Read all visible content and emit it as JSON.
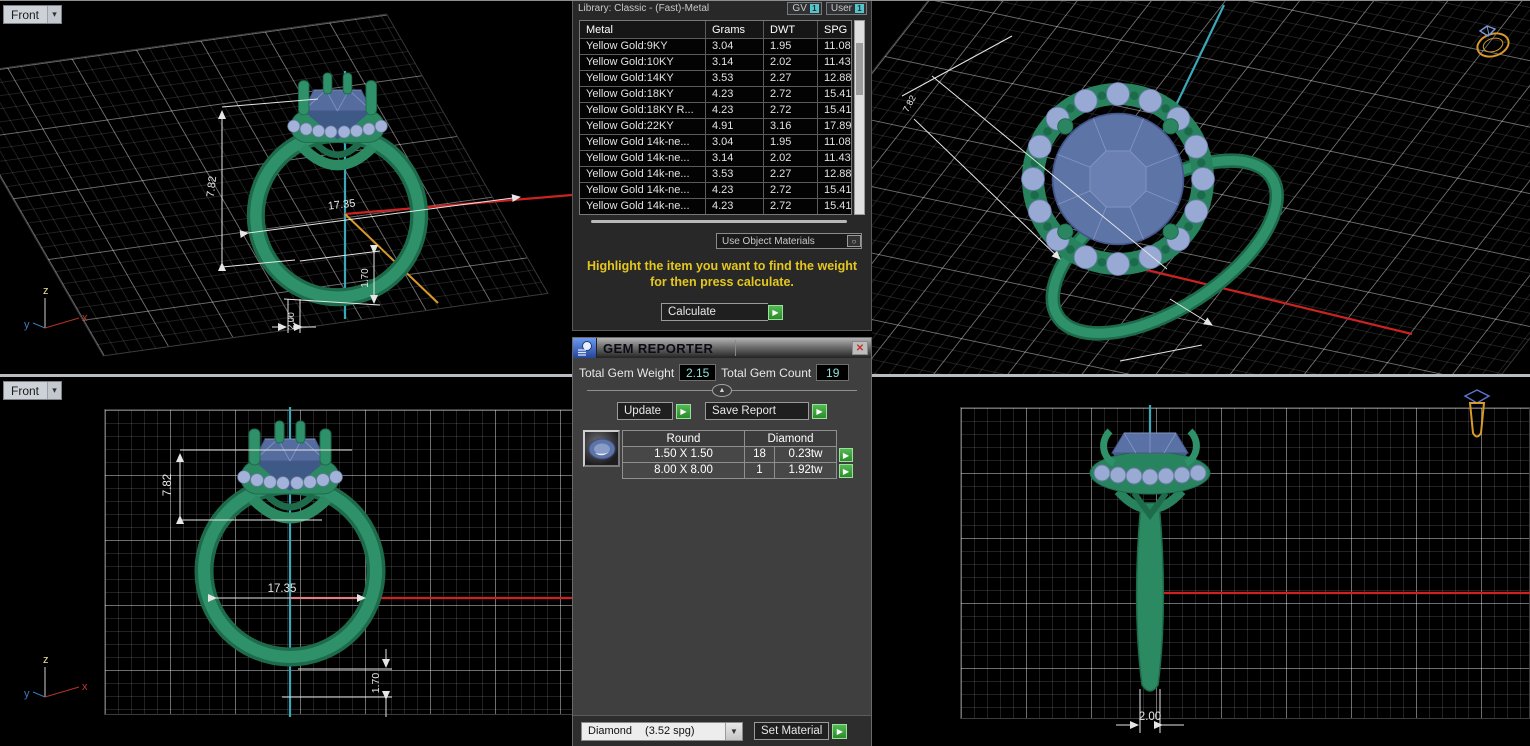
{
  "dims": {
    "head_height": "7.82",
    "ring_diameter": "17.35",
    "band_thickness": "1.70",
    "band_width": "2.00"
  },
  "viewports": {
    "top_left_label": "Front",
    "bottom_left_label": "Front",
    "axis": {
      "x": "x",
      "y": "y",
      "z": "z"
    },
    "caret_icon": "▾"
  },
  "metal_panel": {
    "library_label": "Library: Classic - (Fast)-Metal",
    "gv_button": "GV",
    "user_button": "User",
    "toggle_badge": "1",
    "columns": [
      "Metal",
      "Grams",
      "DWT",
      "SPG"
    ],
    "rows": [
      [
        "Yellow Gold:9KY",
        "3.04",
        "1.95",
        "11.08"
      ],
      [
        "Yellow Gold:10KY",
        "3.14",
        "2.02",
        "11.43"
      ],
      [
        "Yellow Gold:14KY",
        "3.53",
        "2.27",
        "12.88"
      ],
      [
        "Yellow Gold:18KY",
        "4.23",
        "2.72",
        "15.41"
      ],
      [
        "Yellow Gold:18KY R...",
        "4.23",
        "2.72",
        "15.41"
      ],
      [
        "Yellow Gold:22KY",
        "4.91",
        "3.16",
        "17.89"
      ],
      [
        "Yellow Gold 14k-ne...",
        "3.04",
        "1.95",
        "11.08"
      ],
      [
        "Yellow Gold 14k-ne...",
        "3.14",
        "2.02",
        "11.43"
      ],
      [
        "Yellow Gold 14k-ne...",
        "3.53",
        "2.27",
        "12.88"
      ],
      [
        "Yellow Gold 14k-ne...",
        "4.23",
        "2.72",
        "15.41"
      ],
      [
        "Yellow Gold 14k-ne...",
        "4.23",
        "2.72",
        "15.41"
      ]
    ],
    "use_object_materials": "Use Object Materials",
    "radio_icon": "○",
    "instruction_line1": "Highlight the item you want to find the weight",
    "instruction_line2": "for then press calculate.",
    "calculate_label": "Calculate",
    "run_icon": "▶"
  },
  "gem_reporter": {
    "title": "GEM REPORTER",
    "close_icon": "✕",
    "total_weight_label": "Total Gem Weight",
    "total_weight_value": "2.15",
    "total_count_label": "Total Gem Count",
    "total_count_value": "19",
    "collapse_icon": "▲",
    "update_label": "Update",
    "save_report_label": "Save Report",
    "run_icon": "▶",
    "gem_table": {
      "shape_header": "Round",
      "type_header": "Diamond",
      "rows": [
        {
          "size": "1.50 X 1.50",
          "count": "18",
          "weight": "0.23tw"
        },
        {
          "size": "8.00 X 8.00",
          "count": "1",
          "weight": "1.92tw"
        }
      ]
    },
    "material_value": "Diamond",
    "material_spg": "(3.52 spg)",
    "dropdown_icon": "▼",
    "set_material_label": "Set Material"
  },
  "colors": {
    "accent_teal": "#56c4c9",
    "value_teal": "#8fe0da",
    "warning_yellow": "#e5c71e",
    "go_green": "#3aa53a",
    "band_green": "#2f9169",
    "gem_blue": "#5d74a6",
    "axis_red": "#cc2222",
    "axis_cyan": "#3aa8b8",
    "close_red": "#c2332c"
  }
}
